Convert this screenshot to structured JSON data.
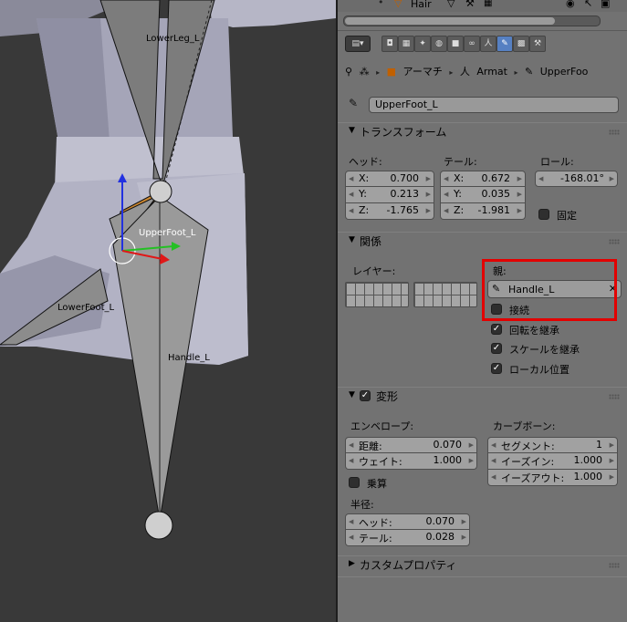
{
  "viewport": {
    "bones": [
      "LowerLeg_L",
      "UpperFoot_L",
      "LowerFoot_L",
      "Handle_L"
    ]
  },
  "outliner": {
    "item": "Hair"
  },
  "breadcrumbs": [
    "アーマチ",
    "Armat",
    "UpperFoo"
  ],
  "bone_name": "UpperFoot_L",
  "transform": {
    "title": "トランスフォーム",
    "head": {
      "label": "ヘッド:",
      "x": "0.700",
      "y": "0.213",
      "z": "-1.765"
    },
    "tail": {
      "label": "テール:",
      "x": "0.672",
      "y": "0.035",
      "z": "-1.981"
    },
    "roll": {
      "label": "ロール:",
      "value": "-168.01°"
    },
    "lock_label": "固定",
    "axis_x": "X:",
    "axis_y": "Y:",
    "axis_z": "Z:"
  },
  "relations": {
    "title": "関係",
    "layer_label": "レイヤー:",
    "parent_label": "親:",
    "parent_value": "Handle_L",
    "connect_label": "接続",
    "inherit_rotation": "回転を継承",
    "inherit_scale": "スケールを継承",
    "local_location": "ローカル位置"
  },
  "deform": {
    "title": "変形",
    "envelope": {
      "label": "エンベロープ:",
      "distance_label": "距離:",
      "distance": "0.070",
      "weight_label": "ウェイト:",
      "weight": "1.000",
      "multiply_label": "乗算"
    },
    "radius": {
      "label": "半径:",
      "head_label": "ヘッド:",
      "head": "0.070",
      "tail_label": "テール:",
      "tail": "0.028"
    },
    "curved": {
      "label": "カーブボーン:",
      "segments_label": "セグメント:",
      "segments": "1",
      "ease_in_label": "イーズイン:",
      "ease_in": "1.000",
      "ease_out_label": "イーズアウト:",
      "ease_out": "1.000"
    }
  },
  "custom_props": {
    "title": "カスタムプロパティ"
  }
}
